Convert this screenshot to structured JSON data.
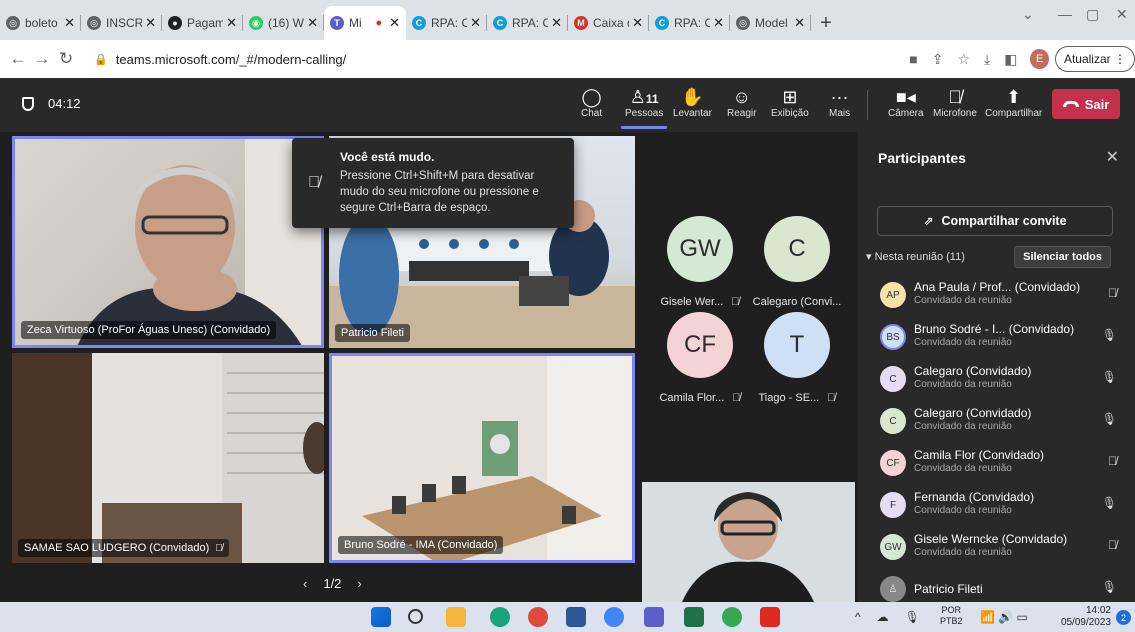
{
  "browser": {
    "tabs": [
      {
        "label": "boleto",
        "icon": "globe-icon",
        "color": "#5f6368"
      },
      {
        "label": "INSCRI",
        "icon": "globe-icon",
        "color": "#5f6368"
      },
      {
        "label": "Pagam",
        "icon": "record-icon",
        "color": "#202124"
      },
      {
        "label": "(16) W",
        "icon": "whatsapp-icon",
        "color": "#25d366"
      },
      {
        "label": "Mi",
        "icon": "teams-icon",
        "color": "#5b5fc7",
        "active": true
      },
      {
        "label": "RPA: O",
        "icon": "c-icon",
        "color": "#0e9fd8"
      },
      {
        "label": "RPA: O",
        "icon": "c-icon",
        "color": "#0e9fd8"
      },
      {
        "label": "Caixa d",
        "icon": "gmail-icon",
        "color": "#d93025"
      },
      {
        "label": "RPA: O",
        "icon": "c-icon",
        "color": "#0e9fd8"
      },
      {
        "label": "Model",
        "icon": "globe-icon",
        "color": "#5f6368"
      }
    ],
    "url": "teams.microsoft.com/_#/modern-calling/",
    "profile_initial": "E",
    "update_label": "Atualizar"
  },
  "teams": {
    "timer": "04:12",
    "controls": {
      "chat": "Chat",
      "people": "Pessoas",
      "people_count": "11",
      "raise": "Levantar",
      "react": "Reagir",
      "view": "Exibição",
      "more": "Mais",
      "camera": "Câmera",
      "mic": "Microfone",
      "share": "Compartilhar",
      "leave": "Sair"
    },
    "toast": {
      "title": "Você está mudo.",
      "body": "Pressione Ctrl+Shift+M para desativar mudo do seu microfone ou pressione e segure Ctrl+Barra de espaço."
    },
    "video_tiles": {
      "t1": "Zeca Virtuoso (ProFor Águas Unesc) (Convidado)",
      "t2": "Patricio Fileti",
      "t3": "SAMAE SAO LUDGERO (Convidado)",
      "t4": "Bruno Sodré - IMA (Convidado)"
    },
    "avatars": [
      {
        "initials": "GW",
        "name": "Gisele Wer...",
        "color": "#d5e8d4"
      },
      {
        "initials": "C",
        "name": "Calegaro (Convi...",
        "color": "#d9e7d1"
      },
      {
        "initials": "CF",
        "name": "Camila Flor...",
        "color": "#f4d3d7"
      },
      {
        "initials": "T",
        "name": "Tiago - SE...",
        "color": "#cfe0f4"
      }
    ],
    "pager": "1/2",
    "panel": {
      "title": "Participantes",
      "invite": "Compartilhar convite",
      "section": "Nesta reunião (11)",
      "mute_all": "Silenciar todos",
      "participants": [
        {
          "initials": "AP",
          "name": "Ana Paula / Prof...  (Convidado)",
          "role": "Convidado da reunião",
          "color": "#f6e3a8",
          "mic": "muted"
        },
        {
          "initials": "BS",
          "name": "Bruno Sodré - I...  (Convidado)",
          "role": "Convidado da reunião",
          "color": "#cfe0f4",
          "mic": "on"
        },
        {
          "initials": "C",
          "name": "Calegaro (Convidado)",
          "role": "Convidado da reunião",
          "color": "#e6ddf2",
          "mic": "on"
        },
        {
          "initials": "C",
          "name": "Calegaro (Convidado)",
          "role": "Convidado da reunião",
          "color": "#d9e7d1",
          "mic": "on"
        },
        {
          "initials": "CF",
          "name": "Camila Flor (Convidado)",
          "role": "Convidado da reunião",
          "color": "#f4d3d7",
          "mic": "muted"
        },
        {
          "initials": "F",
          "name": "Fernanda (Convidado)",
          "role": "Convidado da reunião",
          "color": "#e6ddf2",
          "mic": "on"
        },
        {
          "initials": "GW",
          "name": "Gisele Werncke (Convidado)",
          "role": "Convidado da reunião",
          "color": "#d5e8d4",
          "mic": "muted"
        },
        {
          "initials": "",
          "name": "Patricio Fileti",
          "role": "",
          "color": "#888888",
          "mic": "on"
        }
      ]
    }
  },
  "taskbar": {
    "lang": "POR",
    "lang2": "PTB2",
    "time": "14:02",
    "date": "05/09/2023",
    "notifications": "2"
  }
}
